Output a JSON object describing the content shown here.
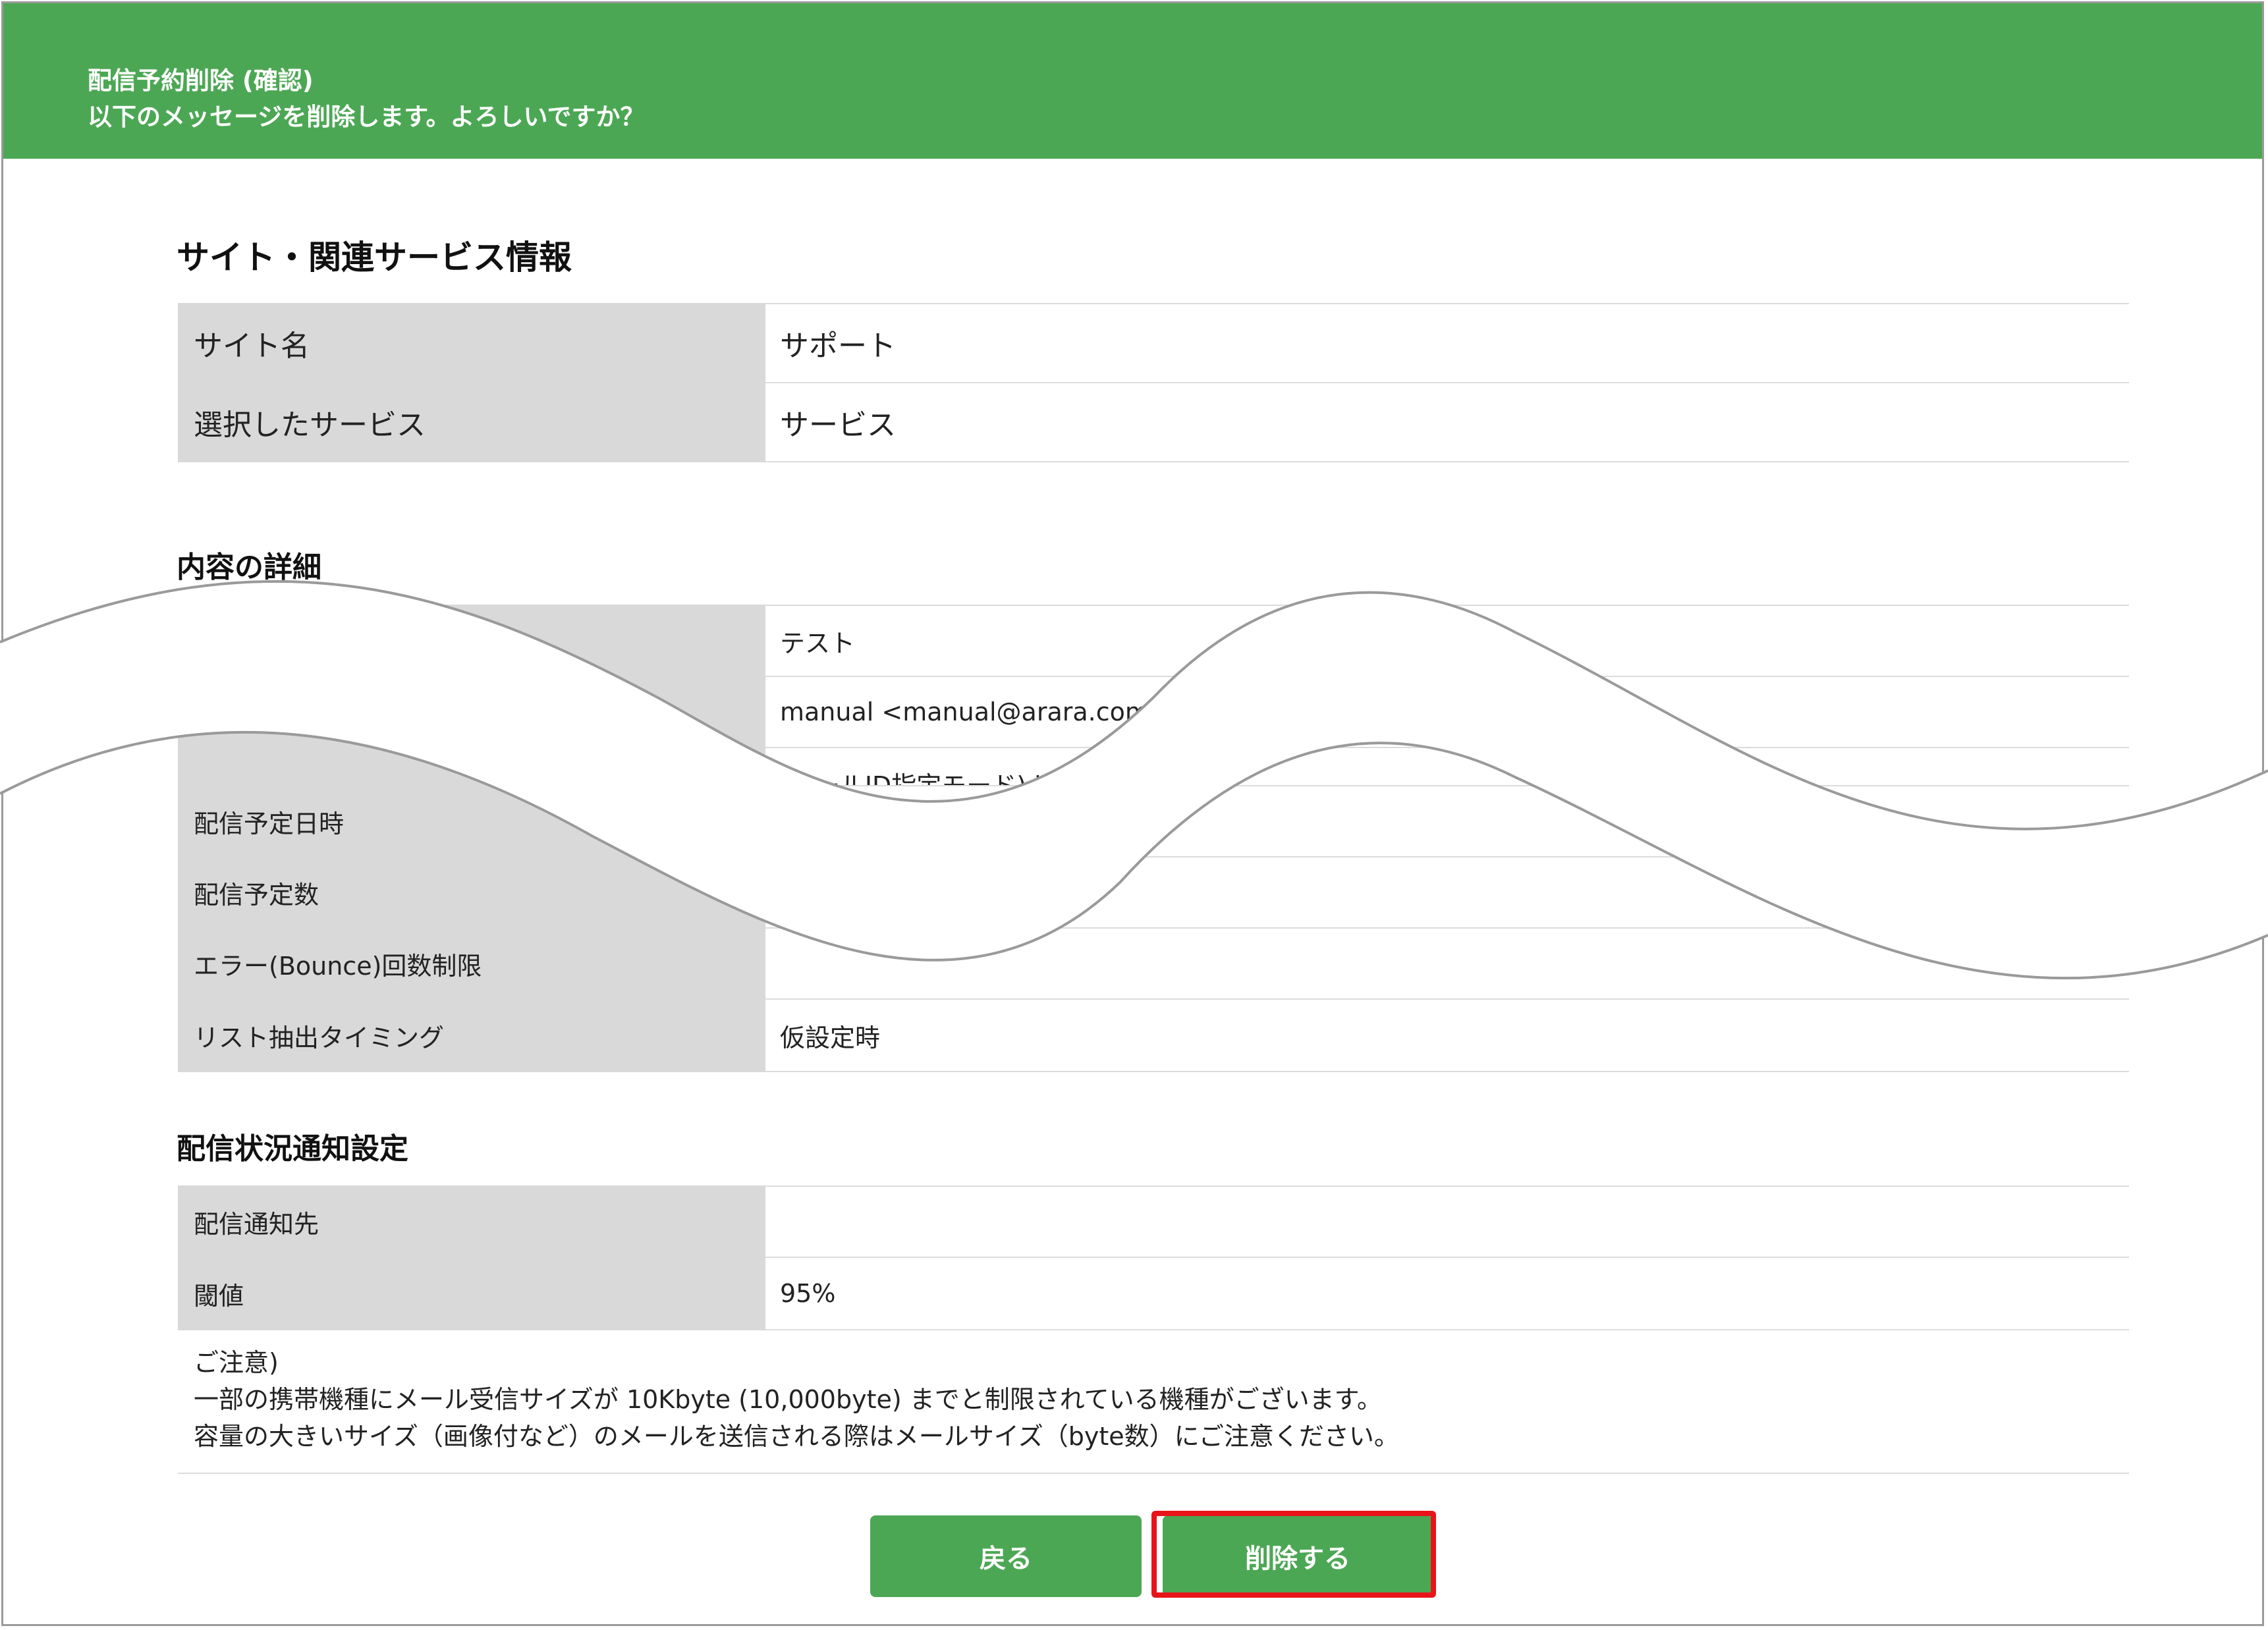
{
  "header": {
    "title": "配信予約削除 (確認)",
    "message": "以下のメッセージを削除します。よろしいですか？"
  },
  "site_section": {
    "title": "サイト・関連サービス情報",
    "rows": [
      {
        "label": "サイト名",
        "value": "サポート"
      },
      {
        "label": "選択したサービス",
        "value": "サービス"
      }
    ]
  },
  "details_section": {
    "title": "内容の詳細",
    "rows": [
      {
        "label": "",
        "value": "テスト"
      },
      {
        "label": "",
        "value": "manual <manual@arara.com>"
      },
      {
        "label": "",
        "value": "(メールID指定モード) b"
      },
      {
        "label": "配信予定日時",
        "value": ""
      },
      {
        "label": "配信予定数",
        "value": ""
      },
      {
        "label": "エラー(Bounce)回数制限",
        "value": ""
      },
      {
        "label": "リスト抽出タイミング",
        "value": "仮設定時"
      }
    ]
  },
  "notify_section": {
    "title": "配信状況通知設定",
    "rows": [
      {
        "label": "配信通知先",
        "value": ""
      },
      {
        "label": "閾値",
        "value": "95%"
      }
    ]
  },
  "note": {
    "line1": "ご注意)",
    "line2": "一部の携帯機種にメール受信サイズが 10Kbyte (10,000byte) までと制限されている機種がございます。",
    "line3": "容量の大きいサイズ（画像付など）のメールを送信される際はメールサイズ（byte数）にご注意ください。"
  },
  "buttons": {
    "back": "戻る",
    "delete": "削除する"
  },
  "colors": {
    "header_bg": "#4ca754",
    "button_bg": "#4ca754",
    "label_bg": "#d9d9d9",
    "highlight": "#e8141a"
  }
}
